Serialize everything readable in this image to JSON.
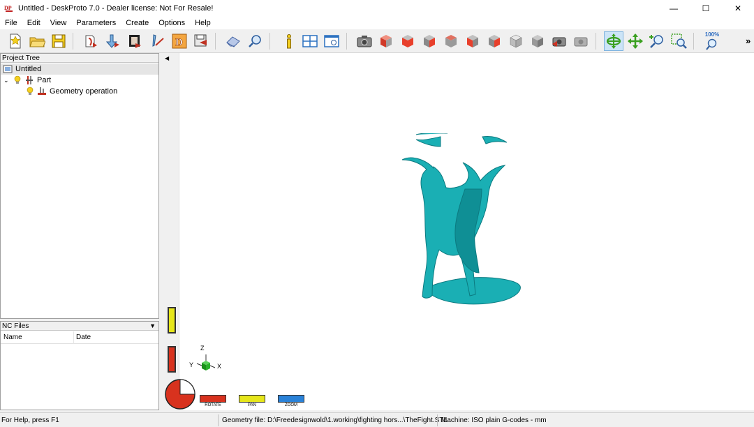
{
  "window": {
    "title": "Untitled - DeskProto 7.0 - Dealer license: Not For Resale!",
    "controls": {
      "minimize": "—",
      "maximize": "☐",
      "close": "✕"
    }
  },
  "menu": [
    "File",
    "Edit",
    "View",
    "Parameters",
    "Create",
    "Options",
    "Help"
  ],
  "toolbar": {
    "zoom_percent": "100%",
    "more": "»",
    "colors": {
      "active_bg": "#cce4f7",
      "red_face": "#e8402c",
      "grey_face": "#9a9a9a"
    }
  },
  "project_tree": {
    "header": "Project Tree",
    "root": "Untitled",
    "part": "Part",
    "operation": "Geometry operation"
  },
  "nc_files": {
    "header": "NC Files",
    "columns": [
      "Name",
      "Date"
    ]
  },
  "viewport": {
    "model_color": "#1aafb4",
    "axes": {
      "z": "Z",
      "y": "Y",
      "x": "X"
    },
    "modes": [
      {
        "label": "ROTATE",
        "color": "#d8321e"
      },
      {
        "label": "PAN",
        "color": "#e6e61a"
      },
      {
        "label": "ZOOM",
        "color": "#2a82d8"
      }
    ]
  },
  "status": {
    "help": "For Help, press F1",
    "geometry": "Geometry file: D:\\Freedesignwold\\1.working\\fighting hors...\\TheFight.STL",
    "machine": "Machine: ISO plain G-codes - mm"
  }
}
